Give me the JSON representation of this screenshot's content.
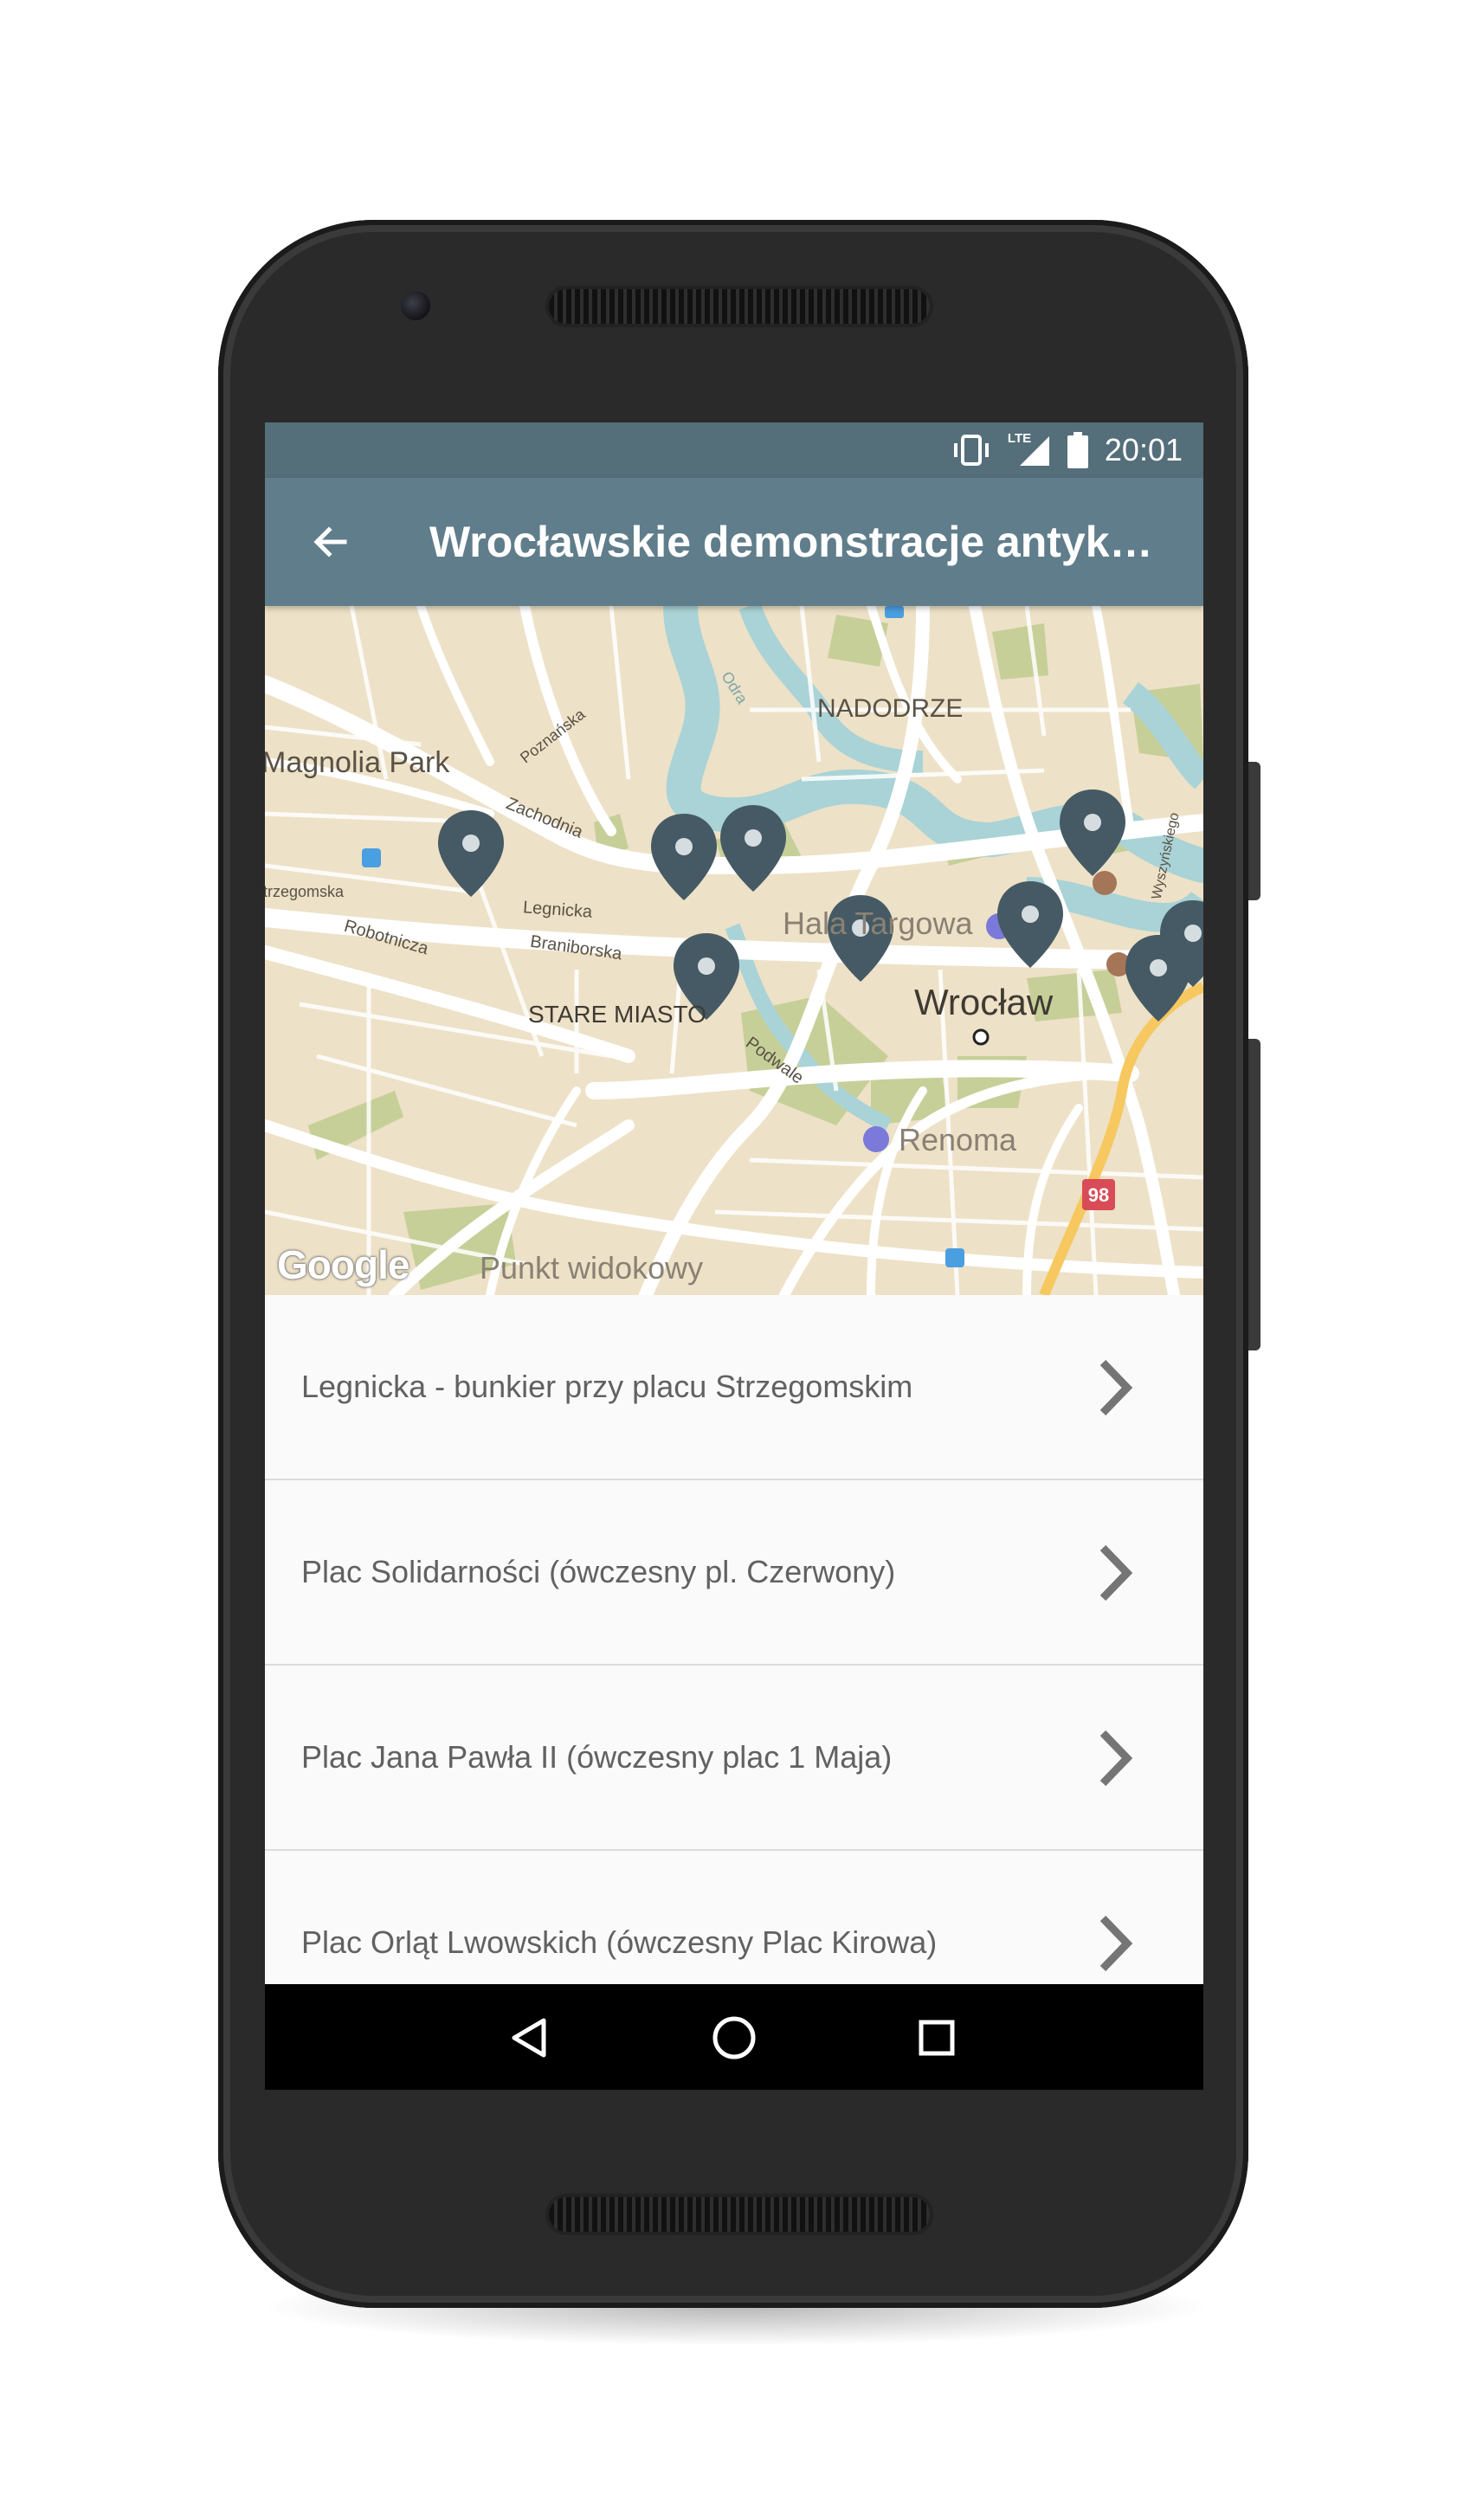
{
  "status_bar": {
    "time": "20:01",
    "network": "LTE",
    "icons": [
      "vibrate-icon",
      "signal-icon",
      "battery-icon"
    ]
  },
  "app_bar": {
    "title": "Wrocławskie demonstracje antyk…",
    "back_icon": "arrow-left-icon",
    "color": "#607d8b",
    "status_color": "#546e7a"
  },
  "map": {
    "labels": {
      "nadodrze": "NADODRZE",
      "magnolia": "Magnolia Park",
      "poznanska": "Poznańska",
      "zachodnia": "Zachodnia",
      "strzegomska": "trzegomska",
      "robotnicza": "Robotnicza",
      "legnicka": "Legnicka",
      "braniborska": "Braniborska",
      "stare_miasto": "STARE MIASTO",
      "hala_targowa": "Hala Targowa",
      "wroclaw": "Wrocław",
      "podwale": "Podwale",
      "renoma": "Renoma",
      "punkt": "Punkt widokowy",
      "odra": "Odra",
      "wyszynskiego": "Wyszyńskiego",
      "route": "98"
    },
    "attribution": "Google",
    "marker_count": 9,
    "marker_color": "#455a64"
  },
  "list": {
    "items": [
      {
        "label": "Legnicka - bunkier przy placu Strzegomskim"
      },
      {
        "label": "Plac Solidarności (ówczesny pl. Czerwony)"
      },
      {
        "label": "Plac Jana Pawła II (ówczesny plac 1 Maja)"
      },
      {
        "label": "Plac Orląt Lwowskich (ówczesny Plac Kirowa)"
      }
    ],
    "chevron_icon": "chevron-right-icon"
  },
  "nav_bar": {
    "buttons": [
      "back-triangle-icon",
      "home-circle-icon",
      "recents-square-icon"
    ]
  }
}
